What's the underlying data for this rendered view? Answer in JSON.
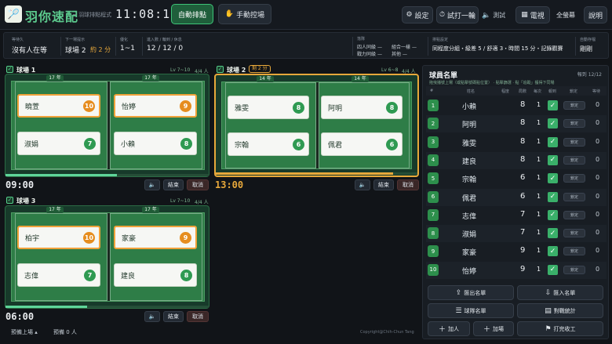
{
  "header": {
    "app_title": "羽你速配",
    "app_subtitle": "~ 羽球排點程式",
    "clock": "11:08:19",
    "auto_mode": "自動排點",
    "manual_mode": "手動控場",
    "settings": "設定",
    "trial": "試打一輪",
    "test": "測試",
    "tv": "電視",
    "fullscreen": "全螢幕",
    "help": "說明"
  },
  "status": {
    "waiting_label": "等待久",
    "waiting_value": "沒有人在等",
    "next_label": "下一場提示",
    "next_value": "球場 2",
    "next_eta": "約 2 分",
    "diff_label": "優化",
    "diff_value": "1~1",
    "counts_label": "進入數 / 輪到 / 休息",
    "counts_value": "12 / 12 / 0",
    "combo_label": "落隊",
    "four_label": "四人同級",
    "four_value": "—",
    "combo2_label": "組合一樣",
    "combo2_value": "—",
    "power_label": "戰力同級",
    "power_value": "—",
    "other_label": "其他",
    "other_value": "—",
    "mode_label": "排點設定",
    "mode_value": "同程度分組・級差 5 / 舒適 3・時間 15 分・記錄觀賽",
    "auto_label": "自動存檔",
    "auto_value": "剛剛"
  },
  "courts": [
    {
      "title": "球場 1",
      "level": "Lv 7~10",
      "people": "4/4 人",
      "tag_left": "17 年",
      "tag_right": "17 年",
      "players": [
        {
          "name": "曉萱",
          "num": "10",
          "color": "orange"
        },
        {
          "name": "怡婷",
          "num": "9",
          "color": "orange"
        },
        {
          "name": "淑娟",
          "num": "7",
          "color": "green"
        },
        {
          "name": "小賴",
          "num": "8",
          "color": "green"
        }
      ],
      "progress": 0.55,
      "time": "09:00",
      "end": "結束",
      "cancel": "取消"
    },
    {
      "title": "球場 2",
      "badge": "剩 2 分",
      "level": "Lv 6~8",
      "people": "4/4 人",
      "tag_left": "14 年",
      "tag_right": "14 年",
      "players": [
        {
          "name": "雅雯",
          "num": "8",
          "color": "green"
        },
        {
          "name": "阿明",
          "num": "8",
          "color": "green"
        },
        {
          "name": "宗翰",
          "num": "6",
          "color": "green"
        },
        {
          "name": "佩君",
          "num": "6",
          "color": "green"
        }
      ],
      "progress": 0.88,
      "time": "13:00",
      "end": "結束",
      "cancel": "取消"
    },
    {
      "title": "球場 3",
      "level": "Lv 7~10",
      "people": "4/4 人",
      "tag_left": "17 年",
      "tag_right": "17 年",
      "players": [
        {
          "name": "柏宇",
          "num": "10",
          "color": "orange"
        },
        {
          "name": "家豪",
          "num": "9",
          "color": "orange"
        },
        {
          "name": "志偉",
          "num": "7",
          "color": "green"
        },
        {
          "name": "建良",
          "num": "8",
          "color": "green"
        }
      ],
      "progress": 0.4,
      "time": "06:00",
      "end": "結束",
      "cancel": "取消"
    }
  ],
  "roster": {
    "title": "球員名單",
    "count": "報到 12/12",
    "hint": "拖曳播號上場（或點擊號碼點位置） · 點擊篩選 · 點「追蹤」獲得下同場",
    "col_num": "#",
    "col_name": "姓名",
    "col_level": "程度",
    "col_games": "局數",
    "col_wait": "每次",
    "col_check": "報到",
    "col_lock": "鎖定",
    "col_wait2": "等待",
    "lock_label": "鎖定",
    "rows": [
      {
        "num": "1",
        "name": "小賴",
        "games": "8",
        "wait": "1",
        "zero": "0"
      },
      {
        "num": "2",
        "name": "阿明",
        "games": "8",
        "wait": "1",
        "zero": "0"
      },
      {
        "num": "3",
        "name": "雅雯",
        "games": "8",
        "wait": "1",
        "zero": "0"
      },
      {
        "num": "4",
        "name": "建良",
        "games": "8",
        "wait": "1",
        "zero": "0"
      },
      {
        "num": "5",
        "name": "宗翰",
        "games": "6",
        "wait": "1",
        "zero": "0"
      },
      {
        "num": "6",
        "name": "佩君",
        "games": "6",
        "wait": "1",
        "zero": "0"
      },
      {
        "num": "7",
        "name": "志偉",
        "games": "7",
        "wait": "1",
        "zero": "0"
      },
      {
        "num": "8",
        "name": "淑娟",
        "games": "7",
        "wait": "1",
        "zero": "0"
      },
      {
        "num": "9",
        "name": "家豪",
        "games": "9",
        "wait": "1",
        "zero": "0"
      },
      {
        "num": "10",
        "name": "怡婷",
        "games": "9",
        "wait": "1",
        "zero": "0"
      }
    ],
    "export": "匯出名單",
    "import": "匯入名單",
    "manage": "球隊名單",
    "stats": "對戰統計",
    "add": "加人",
    "add_court": "加場",
    "finish": "打完收工"
  },
  "footer": {
    "preview": "預備上場",
    "preview_count": "預備 0 人",
    "copyright": "Copyright@Chih-Chun Tang"
  },
  "colors": {
    "accent_green": "#3ec378",
    "accent_orange": "#e7a83b",
    "court_green": "#2e7d47"
  }
}
